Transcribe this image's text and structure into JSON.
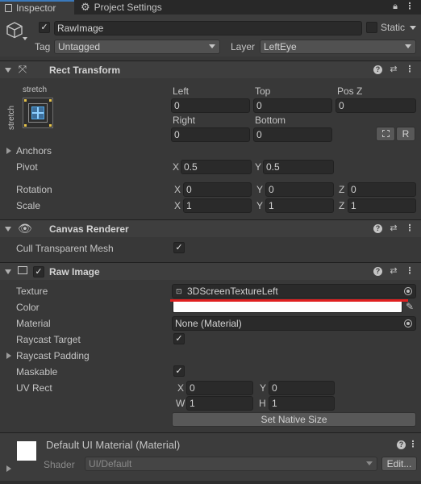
{
  "tabs": {
    "inspector": "Inspector",
    "project_settings": "Project Settings",
    "lock_icon": "lock-icon",
    "menu_icon": "kebab-menu-icon"
  },
  "object": {
    "active": true,
    "name": "RawImage",
    "static_label": "Static",
    "tag_label": "Tag",
    "tag_value": "Untagged",
    "layer_label": "Layer",
    "layer_value": "LeftEye"
  },
  "rect_transform": {
    "title": "Rect Transform",
    "anchor_h": "stretch",
    "anchor_v": "stretch",
    "left_label": "Left",
    "left": "0",
    "top_label": "Top",
    "top": "0",
    "posz_label": "Pos Z",
    "posz": "0",
    "right_label": "Right",
    "right": "0",
    "bottom_label": "Bottom",
    "bottom": "0",
    "r_button": "R",
    "anchors_label": "Anchors",
    "pivot_label": "Pivot",
    "pivot_x": "0.5",
    "pivot_y": "0.5",
    "rotation_label": "Rotation",
    "rot_x": "0",
    "rot_y": "0",
    "rot_z": "0",
    "scale_label": "Scale",
    "scale_x": "1",
    "scale_y": "1",
    "scale_z": "1",
    "x": "X",
    "y": "Y",
    "z": "Z"
  },
  "canvas_renderer": {
    "title": "Canvas Renderer",
    "cull_label": "Cull Transparent Mesh",
    "cull": true
  },
  "raw_image": {
    "title": "Raw Image",
    "enabled": true,
    "texture_label": "Texture",
    "texture_value": "3DScreenTextureLeft",
    "color_label": "Color",
    "color_value": "#ffffff",
    "material_label": "Material",
    "material_value": "None (Material)",
    "raycast_target_label": "Raycast Target",
    "raycast_target": true,
    "raycast_padding_label": "Raycast Padding",
    "maskable_label": "Maskable",
    "maskable": true,
    "uvrect_label": "UV Rect",
    "uv_x": "0",
    "uv_y": "0",
    "uv_w": "1",
    "uv_h": "1",
    "w": "W",
    "h": "H",
    "set_native_size": "Set Native Size"
  },
  "material": {
    "title": "Default UI Material (Material)",
    "shader_label": "Shader",
    "shader_value": "UI/Default",
    "edit_button": "Edit..."
  },
  "colors": {
    "accent_tab": "#3a79bb",
    "annotation_red": "#e02020",
    "panel_bg": "#383838",
    "header_bg": "#3e3e3e"
  }
}
